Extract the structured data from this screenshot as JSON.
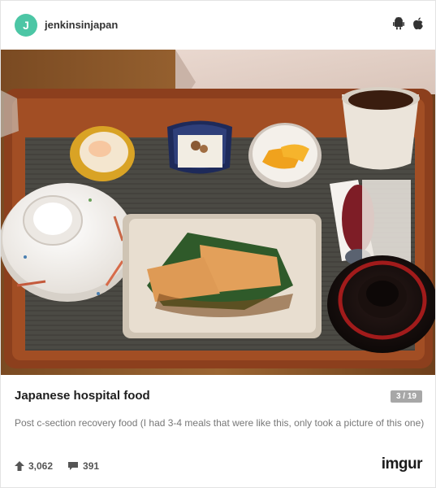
{
  "header": {
    "avatar_letter": "J",
    "username": "jenkinsinjapan",
    "icons": [
      "android-icon",
      "apple-icon"
    ]
  },
  "post": {
    "title": "Japanese hospital food",
    "counter": "3 / 19",
    "description": "Post c-section recovery food (I had 3-4 meals that were like this, only took a picture of this one)"
  },
  "stats": {
    "upvotes": "3,062",
    "comments": "391"
  },
  "footer": {
    "brand": "imgur"
  },
  "colors": {
    "avatar": "#4cc6a5",
    "counter_bg": "#a7a7a7",
    "brand_dot": "#4cc6a5"
  }
}
